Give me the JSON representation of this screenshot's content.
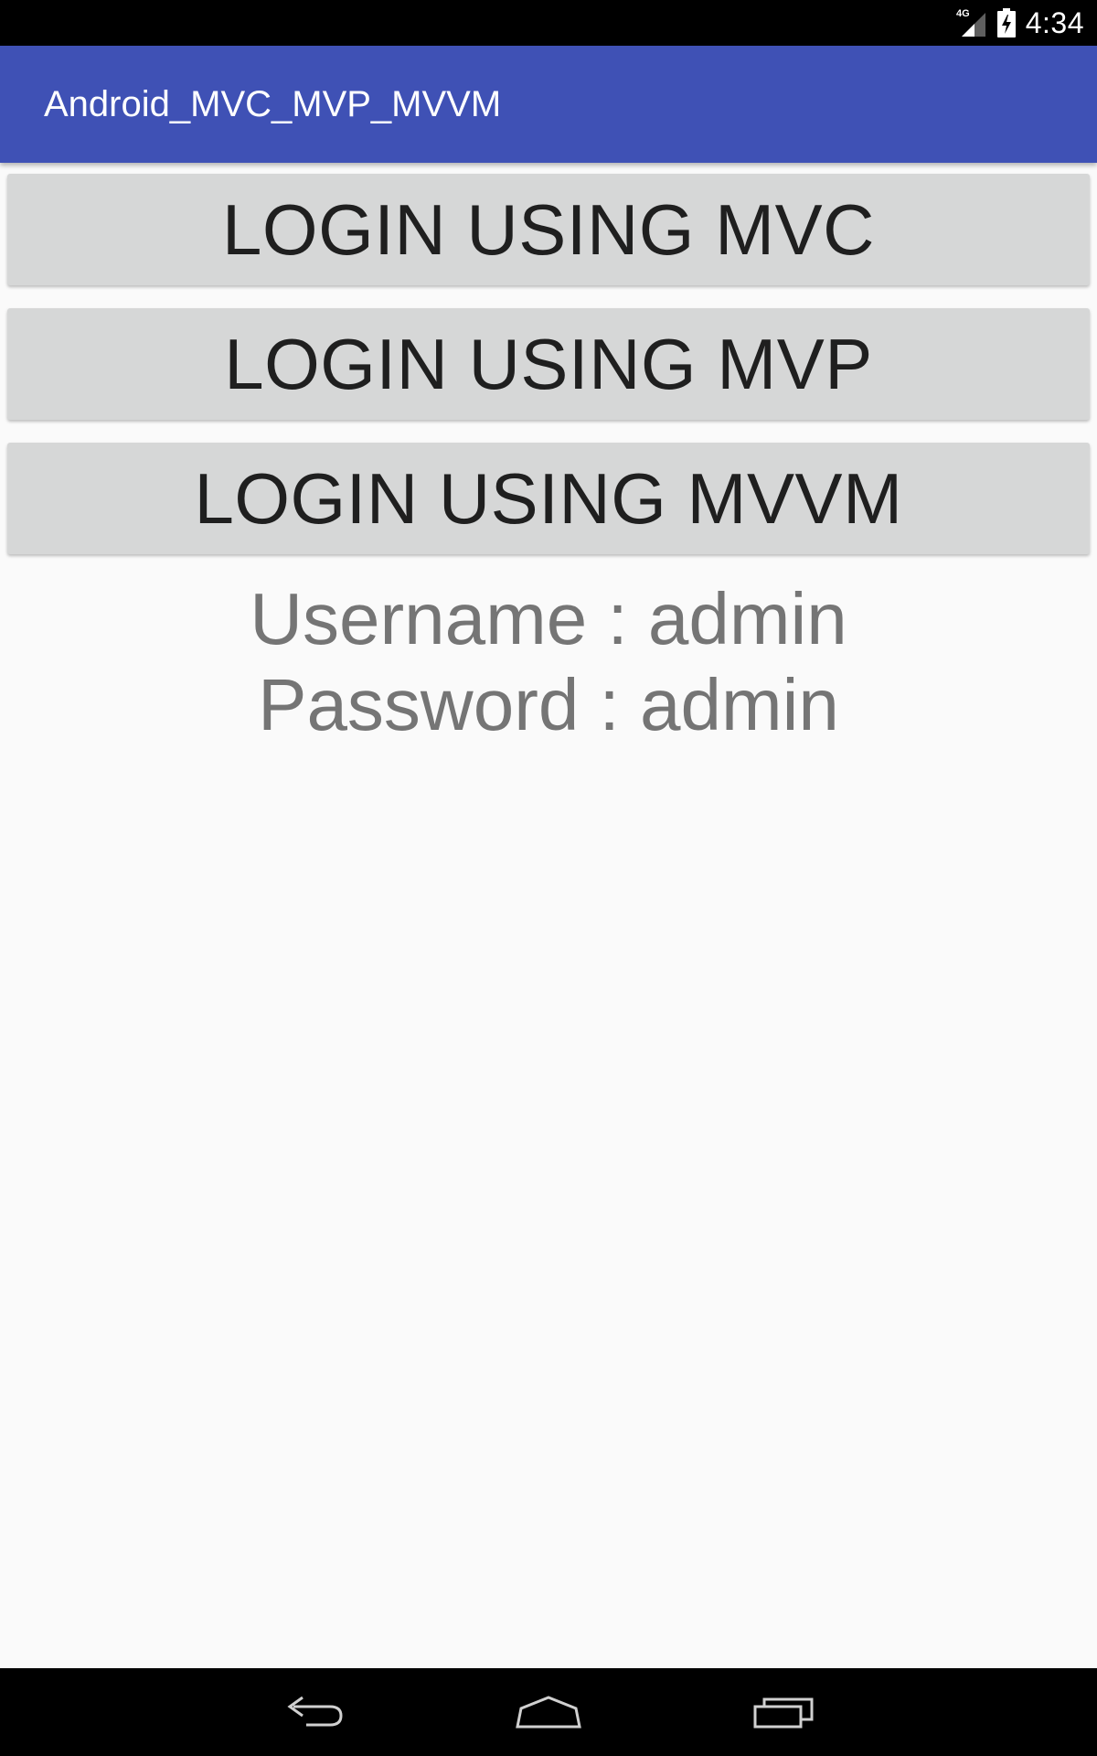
{
  "status_bar": {
    "network_label": "4G",
    "time": "4:34"
  },
  "app_bar": {
    "title": "Android_MVC_MVP_MVVM"
  },
  "buttons": {
    "mvc": "LOGIN USING MVC",
    "mvp": "LOGIN USING MVP",
    "mvvm": "LOGIN USING MVVM"
  },
  "credentials": {
    "username": "Username : admin",
    "password": "Password : admin"
  },
  "icons": {
    "signal": "signal-icon",
    "battery": "battery-charging-icon",
    "back": "back-icon",
    "home": "home-icon",
    "recents": "recents-icon"
  },
  "colors": {
    "app_bar": "#3f51b5",
    "button_bg": "#d6d7d7",
    "credentials_text": "#757575",
    "background": "#fafafa"
  }
}
